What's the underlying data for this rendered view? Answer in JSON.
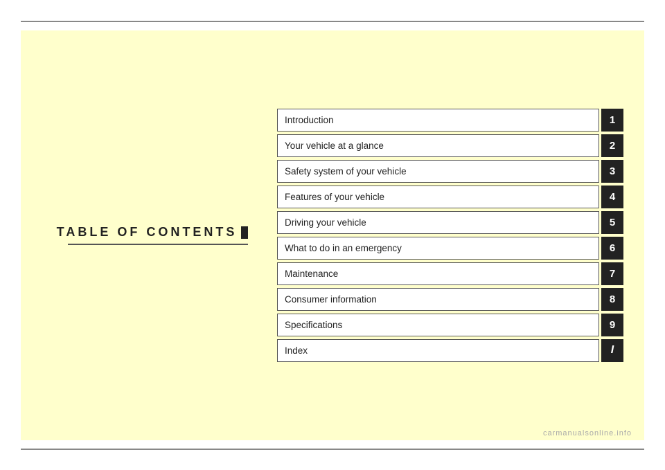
{
  "header": {
    "line": true
  },
  "left": {
    "label": "TABLE  OF  CONTENTS"
  },
  "toc": {
    "items": [
      {
        "label": "Introduction",
        "number": "1",
        "isIndex": false
      },
      {
        "label": "Your vehicle at a glance",
        "number": "2",
        "isIndex": false
      },
      {
        "label": "Safety system of your vehicle",
        "number": "3",
        "isIndex": false
      },
      {
        "label": "Features of your vehicle",
        "number": "4",
        "isIndex": false
      },
      {
        "label": "Driving your vehicle",
        "number": "5",
        "isIndex": false
      },
      {
        "label": "What to do in an emergency",
        "number": "6",
        "isIndex": false
      },
      {
        "label": "Maintenance",
        "number": "7",
        "isIndex": false
      },
      {
        "label": "Consumer information",
        "number": "8",
        "isIndex": false
      },
      {
        "label": "Specifications",
        "number": "9",
        "isIndex": false
      },
      {
        "label": "Index",
        "number": "I",
        "isIndex": true
      }
    ]
  },
  "watermark": {
    "text": "carmanualsonline.info"
  }
}
